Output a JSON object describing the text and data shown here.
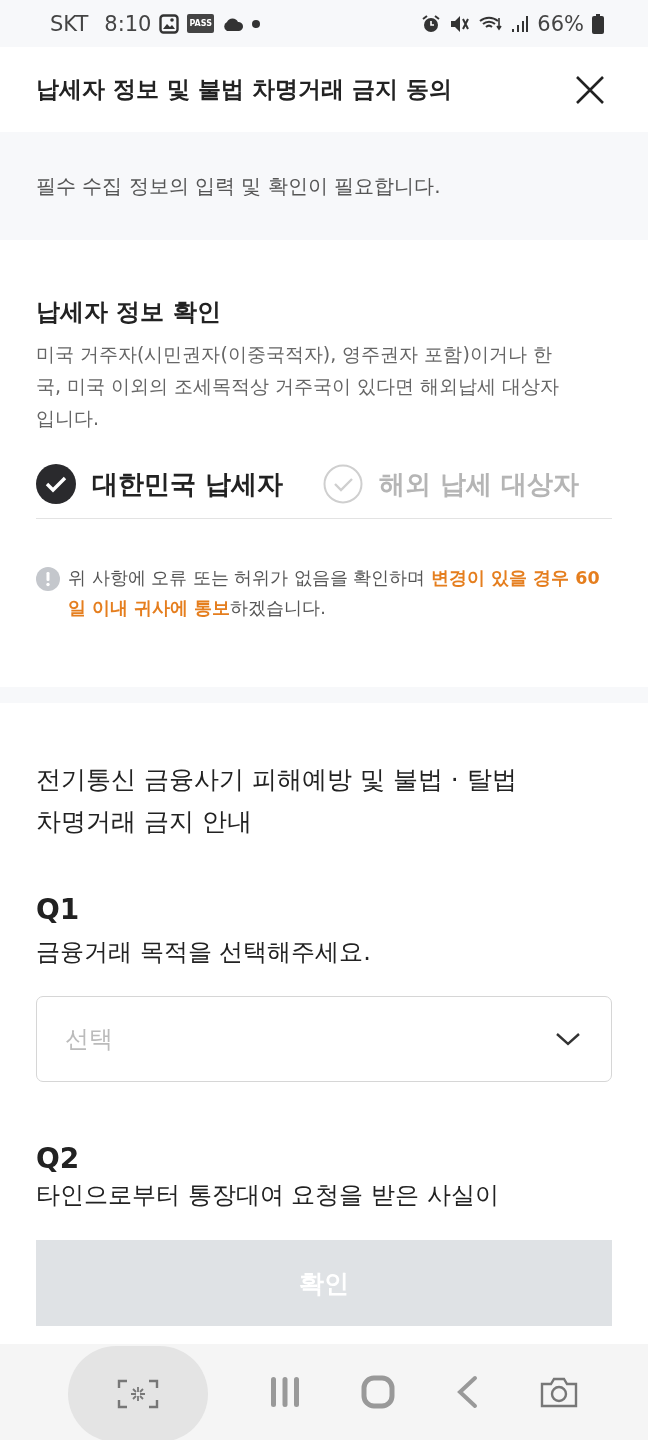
{
  "status_bar": {
    "carrier": "SKT",
    "time": "8:10",
    "pass_badge": "PASS",
    "battery": "66%"
  },
  "header": {
    "title": "납세자 정보 및 불법 차명거래 금지 동의"
  },
  "notice": "필수 수집 정보의 입력 및 확인이 필요합니다.",
  "taxpayer": {
    "title": "납세자 정보 확인",
    "description": "미국 거주자(시민권자(이중국적자), 영주권자 포함)이거나 한국, 미국 이외의 조세목적상 거주국이 있다면 해외납세 대상자 입니다.",
    "options": [
      {
        "label": "대한민국 납세자",
        "selected": true
      },
      {
        "label": "해외 납세 대상자",
        "selected": false
      }
    ],
    "confirmation": "위 사항에 오류 또는 허위가 없음을 확인하며 **변경이 있을 경우 60일 이내 귀사에 통보**하겠습니다."
  },
  "guide": {
    "title": "전기통신 금융사기 피해예방 및 불법 · 탈법 차명거래 금지 안내",
    "questions": [
      {
        "number": "Q1",
        "text": "금융거래 목적을 선택해주세요.",
        "kind": "select",
        "placeholder": "선택"
      },
      {
        "number": "Q2",
        "text": "타인으로부터 통장대여 요청을 받은 사실이",
        "kind": "cut"
      }
    ]
  },
  "confirm_button": {
    "label": "확인",
    "disabled": true
  }
}
